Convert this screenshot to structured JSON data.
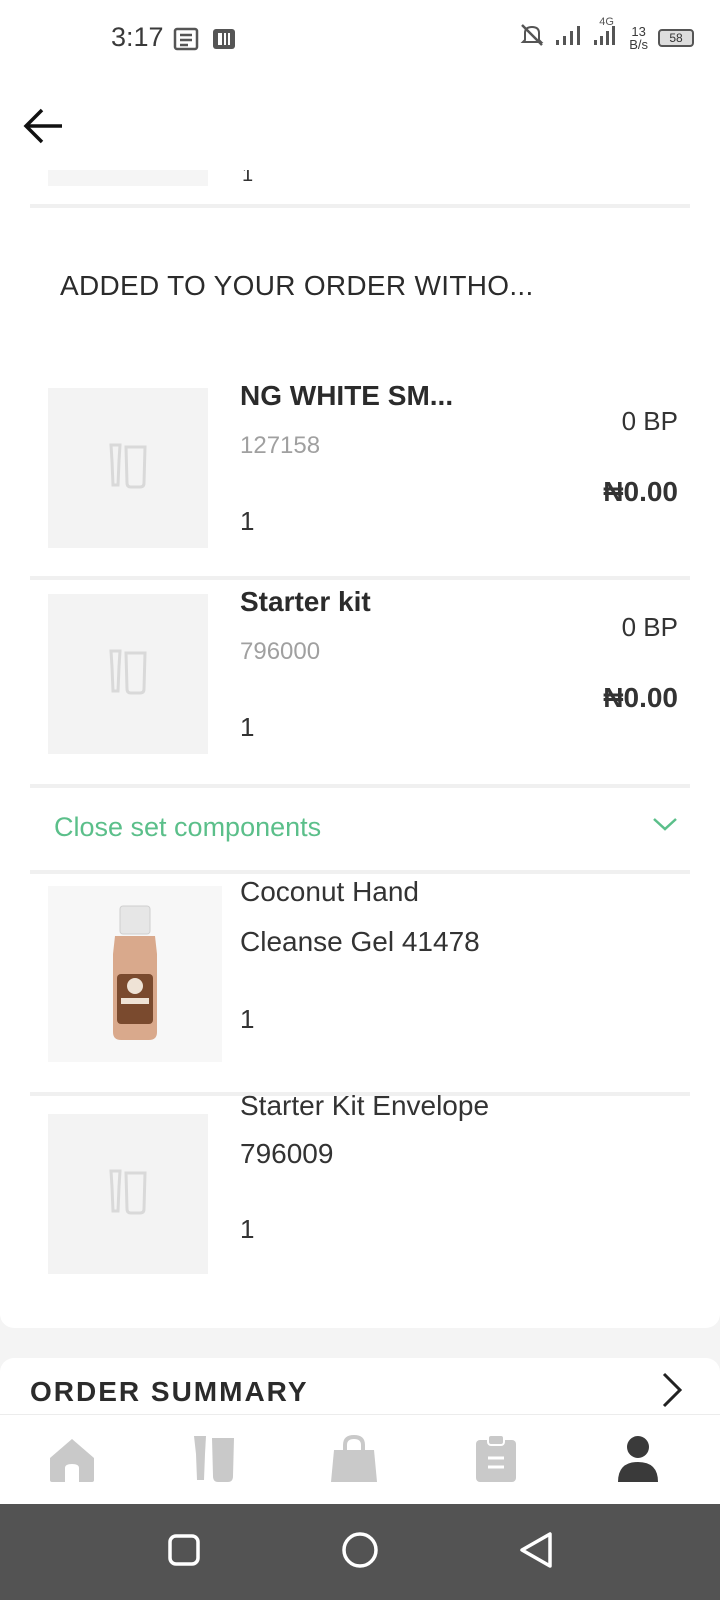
{
  "status_bar": {
    "time": "3:17",
    "network_type": "4G",
    "net_speed_value": "13",
    "net_speed_unit": "B/s",
    "battery": "58"
  },
  "header": {
    "back_icon": "arrow-left-icon"
  },
  "section": {
    "title": "ADDED TO YOUR ORDER WITHO..."
  },
  "remnant": {
    "text": "1"
  },
  "products": [
    {
      "name": "NG WHITE SM...",
      "code": "127158",
      "quantity": "1",
      "bp": "0 BP",
      "price": "₦0.00"
    },
    {
      "name": "Starter kit",
      "code": "796000",
      "quantity": "1",
      "bp": "0 BP",
      "price": "₦0.00"
    }
  ],
  "close_set": {
    "label": "Close set components",
    "icon": "chevron-down-icon"
  },
  "components": [
    {
      "line1": "Coconut Hand",
      "line2": "Cleanse Gel 41478",
      "quantity": "1"
    },
    {
      "line1": "Starter Kit Envelope",
      "line2": "796009",
      "quantity": "1"
    }
  ],
  "order_summary": {
    "title": "ORDER SUMMARY"
  },
  "bottom_nav": {
    "items": [
      "home-icon",
      "products-icon",
      "shopping-bag-icon",
      "orders-clipboard-icon",
      "profile-icon"
    ],
    "active_index": 4
  },
  "colors": {
    "accent_green": "#5bbf8a",
    "nav_inactive": "#c9c9c9",
    "nav_active": "#3a3a3a",
    "system_bar": "#535353"
  }
}
